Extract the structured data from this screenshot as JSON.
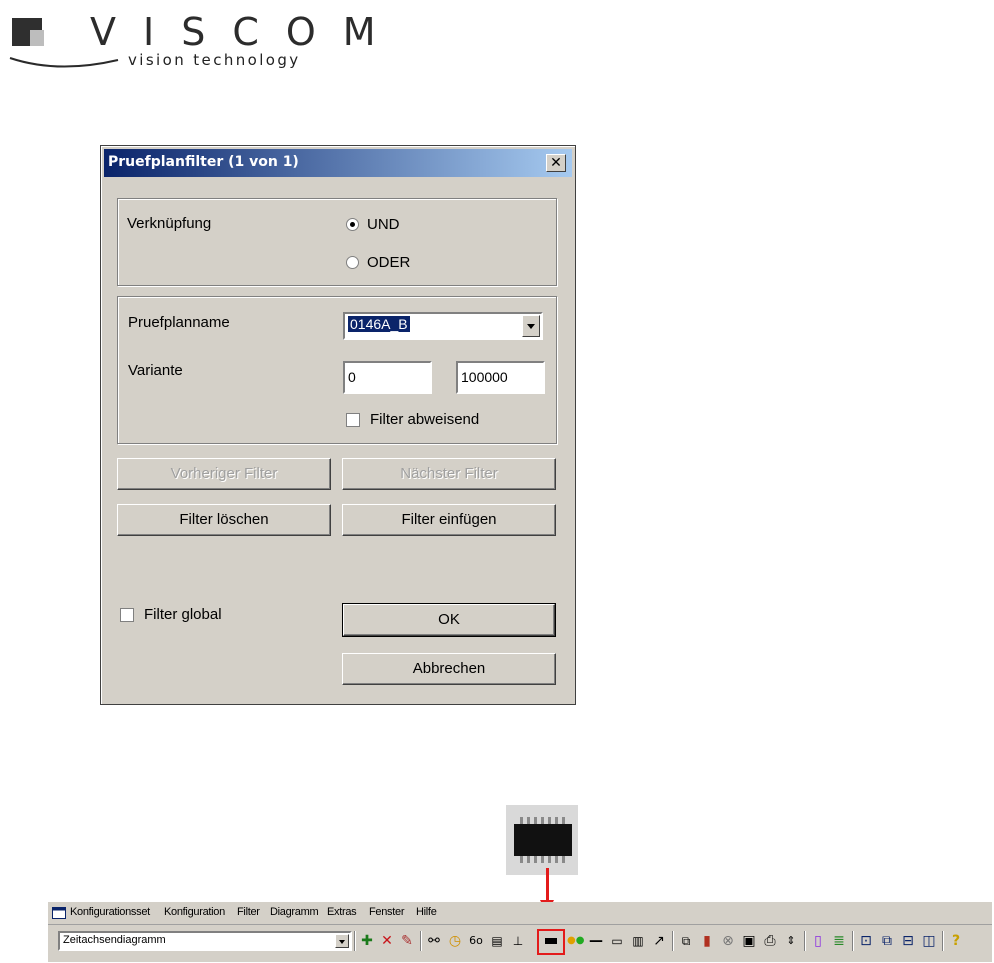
{
  "logo": {
    "brand": "VISCOM",
    "tagline": "vision technology"
  },
  "dialog": {
    "title": "Pruefplanfilter (1 von 1)",
    "close_symbol": "✕",
    "verknuepfung": {
      "label": "Verknüpfung",
      "options": [
        "UND",
        "ODER"
      ],
      "selected": "UND"
    },
    "pruefplanname": {
      "label": "Pruefplanname",
      "value": "0146A_B"
    },
    "variante": {
      "label": "Variante",
      "from": "0",
      "to": "100000"
    },
    "filter_abweisend_label": "Filter abweisend",
    "buttons": {
      "prev": "Vorheriger Filter",
      "next": "Nächster Filter",
      "clear": "Filter löschen",
      "insert": "Filter einfügen",
      "ok": "OK",
      "cancel": "Abbrechen"
    },
    "filter_global_label": "Filter global"
  },
  "app": {
    "menu": [
      "Konfigurationsset",
      "Konfiguration",
      "Filter",
      "Diagramm",
      "Extras",
      "Fenster",
      "Hilfe"
    ],
    "view_select_value": "Zeitachsendiagramm",
    "icons": [
      "plus-icon",
      "delete-icon",
      "pencil-icon",
      "binoculars-icon",
      "clock-icon",
      "glasses-icon",
      "document-icon",
      "underline-icon",
      "component-icon",
      "dots-icon",
      "line-icon",
      "window-icon",
      "panel-icon",
      "wrench-icon",
      "export-icon",
      "chart-icon",
      "cancel-icon",
      "save-icon",
      "print-icon",
      "updown-icon",
      "page-icon",
      "stack-icon",
      "new-window-icon",
      "cascade-icon",
      "tile-h-icon",
      "tile-v-icon",
      "help-icon"
    ],
    "highlight_color": "#e31b1b"
  }
}
